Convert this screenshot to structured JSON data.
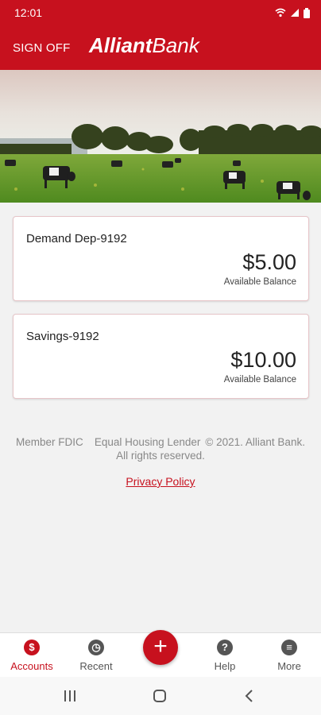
{
  "status_bar": {
    "time": "12:01"
  },
  "header": {
    "sign_off_label": "SIGN OFF",
    "logo_bold": "Alliant",
    "logo_regular": "Bank"
  },
  "accounts": [
    {
      "name": "Demand Dep-9192",
      "balance": "$5.00",
      "caption": "Available Balance"
    },
    {
      "name": "Savings-9192",
      "balance": "$10.00",
      "caption": "Available Balance"
    }
  ],
  "footer": {
    "member_fdic": "Member FDIC",
    "equal_housing": "Equal Housing Lender",
    "copyright": "© 2021. Alliant Bank.",
    "rights": "All rights reserved.",
    "privacy_policy": "Privacy Policy"
  },
  "bottom_nav": {
    "items": [
      {
        "label": "Accounts",
        "icon": "accounts-icon",
        "glyph": "$",
        "active": true
      },
      {
        "label": "Recent",
        "icon": "clock-icon",
        "glyph": "◷"
      },
      {
        "label": "Help",
        "icon": "help-icon",
        "glyph": "?"
      },
      {
        "label": "More",
        "icon": "more-icon",
        "glyph": "≡"
      }
    ],
    "fab_glyph": "+"
  },
  "colors": {
    "brand_red": "#c7111e",
    "background": "#f2f2f2"
  }
}
